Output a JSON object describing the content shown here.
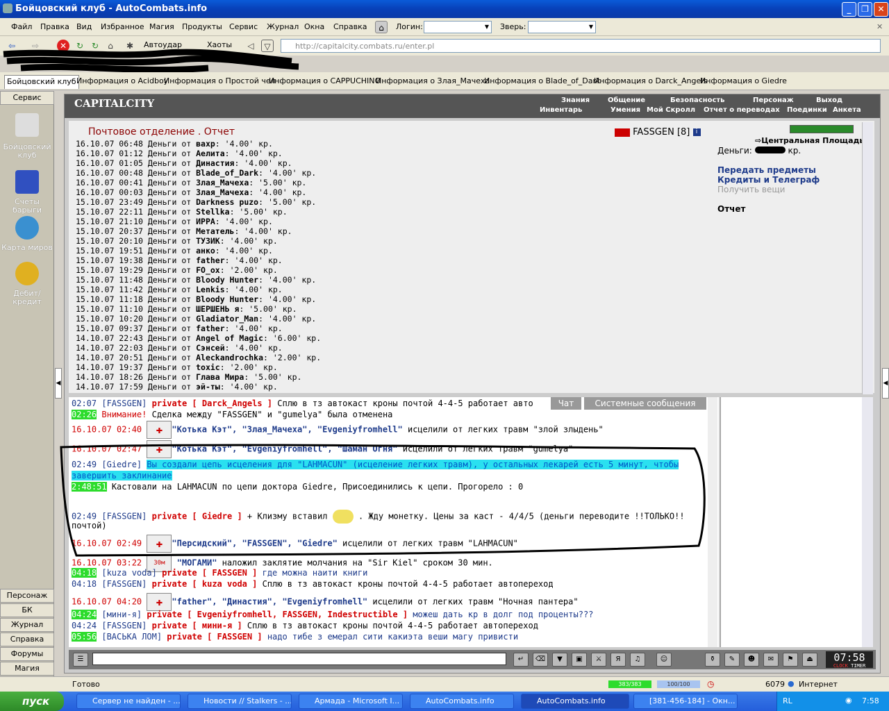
{
  "window": {
    "title": "Бойцовский клуб - AutoCombats.info"
  },
  "menu": {
    "items": [
      "Файл",
      "Правка",
      "Вид",
      "Избранное",
      "Магия",
      "Продукты",
      "Сервис",
      "Журнал",
      "Окна",
      "Справка"
    ],
    "login_label": "Логин:",
    "pet_label": "Зверь:"
  },
  "toolbar": {
    "autostrike": "Автоудар",
    "chaos": "Хаоты",
    "url": "http://capitalcity.combats.ru/enter.pl"
  },
  "tabs": [
    "Бойцовский клуб",
    "Информация о Acidboy",
    "Информация о Простой чел",
    "Информация о CAPPUCHINO",
    "Информация о Злая_Мачеха",
    "Информация о Blade_of_Dark",
    "Информация о Darck_Angels",
    "Информация о Giedre"
  ],
  "sidebar": {
    "header": "Сервис",
    "apps": [
      "Бойцовский клуб",
      "Счеты барыги",
      "Карта миров",
      "Дебит/кредит"
    ],
    "bottom": [
      "Персонаж",
      "БК",
      "Журнал",
      "Справка",
      "Форумы",
      "Магия"
    ]
  },
  "game": {
    "logo": "CAPITALCITY",
    "nav_top": [
      "Знания",
      "Общение",
      "Безопасность",
      "Персонаж",
      "Выход"
    ],
    "nav_bottom": [
      "Инвентарь",
      "Умения",
      "Мой Скролл",
      "Отчет о переводах",
      "Поединки",
      "Анкета"
    ],
    "page_title": "Почтовое отделение .  Отчет",
    "player": "FASSGEN [8]",
    "location": "Центральная Площадь",
    "money_label": "Деньги:",
    "money_suffix": "кр.",
    "links": [
      "Передать предметы",
      "Кредиты и Телеграф"
    ],
    "disabled_link": "Получить вещи",
    "current": "Отчет",
    "log": [
      {
        "d": "16.10.07 06:48 Деньги от ",
        "n": "вахр",
        "v": ": '4.00' кр."
      },
      {
        "d": "16.10.07 01:12 Деньги от ",
        "n": "Аелита",
        "v": ": '4.00' кр."
      },
      {
        "d": "16.10.07 01:05 Деньги от ",
        "n": "Династия",
        "v": ": '4.00' кр."
      },
      {
        "d": "16.10.07 00:48 Деньги от ",
        "n": "Blade_of_Dark",
        "v": ": '4.00' кр."
      },
      {
        "d": "16.10.07 00:41 Деньги от ",
        "n": "Злая_Мачеха",
        "v": ": '5.00' кр."
      },
      {
        "d": "16.10.07 00:03 Деньги от ",
        "n": "Злая_Мачеха",
        "v": ": '4.00' кр."
      },
      {
        "d": "15.10.07 23:49 Деньги от ",
        "n": "Darkness puzo",
        "v": ": '5.00' кр."
      },
      {
        "d": "15.10.07 22:11 Деньги от ",
        "n": "Stellka",
        "v": ": '5.00' кр."
      },
      {
        "d": "15.10.07 21:10 Деньги от ",
        "n": "ИРРА",
        "v": ": '4.00' кр."
      },
      {
        "d": "15.10.07 20:37 Деньги от ",
        "n": "Метатель",
        "v": ": '4.00' кр."
      },
      {
        "d": "15.10.07 20:10 Деньги от ",
        "n": "ТУЗИК",
        "v": ": '4.00' кр."
      },
      {
        "d": "15.10.07 19:51 Деньги от ",
        "n": "анко",
        "v": ": '4.00' кр."
      },
      {
        "d": "15.10.07 19:38 Деньги от ",
        "n": "father",
        "v": ": '4.00' кр."
      },
      {
        "d": "15.10.07 19:29 Деньги от ",
        "n": "FO_ox",
        "v": ": '2.00' кр."
      },
      {
        "d": "15.10.07 11:48 Деньги от ",
        "n": "Bloody Hunter",
        "v": ": '4.00' кр."
      },
      {
        "d": "15.10.07 11:42 Деньги от ",
        "n": "Lenkis",
        "v": ": '4.00' кр."
      },
      {
        "d": "15.10.07 11:18 Деньги от ",
        "n": "Bloody Hunter",
        "v": ": '4.00' кр."
      },
      {
        "d": "15.10.07 11:10 Деньги от ",
        "n": "ШЕРШЕНЬ я",
        "v": ": '5.00' кр."
      },
      {
        "d": "15.10.07 10:20 Деньги от ",
        "n": "Gladiator_Man",
        "v": ": '4.00' кр."
      },
      {
        "d": "15.10.07 09:37 Деньги от ",
        "n": "father",
        "v": ": '4.00' кр."
      },
      {
        "d": "14.10.07 22:43 Деньги от ",
        "n": "Angel of Magic",
        "v": ": '6.00' кр."
      },
      {
        "d": "14.10.07 22:03 Деньги от ",
        "n": "Сэнсей",
        "v": ": '4.00' кр."
      },
      {
        "d": "14.10.07 20:51 Деньги от ",
        "n": "Aleckandrochka",
        "v": ": '2.00' кр."
      },
      {
        "d": "14.10.07 19:37 Деньги от ",
        "n": "toxic",
        "v": ": '2.00' кр."
      },
      {
        "d": "14.10.07 18:26 Деньги от ",
        "n": "Глава Мира",
        "v": ": '5.00' кр."
      },
      {
        "d": "14.10.07 17:59 Деньги от ",
        "n": "эй-ты",
        "v": ": '4.00' кр."
      }
    ]
  },
  "chat": {
    "tab_chat": "Чат",
    "tab_system": "Системные сообщения",
    "l1_time": "02:07",
    "l1_user": "[FASSGEN]",
    "l1_priv": "private [ Darck_Angels ]",
    "l1_msg": "Сплю в тз автокаст кроны почтой 4-4-5 работает авто",
    "l2_time": "02:26",
    "l2_warn": "Внимание!",
    "l2_msg": "Сделка между \"FASSGEN\" и \"gumelya\" была отменена",
    "l3_time": "16.10.07 02:40",
    "l3_names": "\"Котька Кэт\", \"Злая_Мачеха\", \"Evgeniyfromhell\"",
    "l3_msg": "исцелили от легких травм \"злой злыдень\"",
    "l4_time": "16.10.07 02:47",
    "l4_names": "\"Котька Кэт\", \"Evgeniyfromhell\", \"Шаман Огня\"",
    "l4_msg": "исцелили от легких травм \"gumelya\"",
    "l5_time": "02:49",
    "l5_user": "[Giedre]",
    "l5_msg": "Вы создали цепь исцеления для \"LAHMACUN\" (исцеление легких травм), у остальных лекарей есть 5 минут, чтобы",
    "l5_msg2": "завершить заклинание",
    "l6_time": "2:48:51",
    "l6_msg": "Кастовали на LAHMACUN по цепи доктора Giedre, Присоединились к цепи. Прогорело : 0",
    "l7_time": "02:49",
    "l7_user": "[FASSGEN]",
    "l7_priv": "private [ Giedre ]",
    "l7_msg": "+ Клизму вставил",
    "l7_msg2": ". Жду монетку. Цены за каст - 4/4/5 (деньги переводите !!ТОЛЬКО!!",
    "l7_msg3": "почтой)",
    "l8_time": "16.10.07 02:49",
    "l8_names": "\"Персидский\", \"FASSGEN\", \"Giedre\"",
    "l8_msg": "исцелили от легких травм \"LAHMACUN\"",
    "l9_time": "16.10.07 03:22",
    "l9_badge": "30м",
    "l9_names": "\"МОГАМИ\"",
    "l9_msg": "наложил заклятие молчания на \"Sir Kiel\" сроком 30 мин.",
    "l10_time": "04:18",
    "l10_user": "[kuza voda]",
    "l10_priv": "private [ FASSGEN ]",
    "l10_msg": "где можна наити книги",
    "l11_time": "04:18",
    "l11_user": "[FASSGEN]",
    "l11_priv": "private [ kuza voda ]",
    "l11_msg": "Сплю в тз автокаст кроны почтой 4-4-5 работает автопереход",
    "l12_time": "16.10.07 04:20",
    "l12_names": "\"father\", \"Династия\", \"Evgeniyfromhell\"",
    "l12_msg": "исцелили от легких травм \"Ночная пантера\"",
    "l13_time": "04:24",
    "l13_user": "[мини-я]",
    "l13_priv": "private [ Evgeniyfromhell, FASSGEN, Indestructible ]",
    "l13_msg": "можеш дать кр в долг под проценты???",
    "l14_time": "04:24",
    "l14_user": "[FASSGEN]",
    "l14_priv": "private [ мини-я ]",
    "l14_msg": "Сплю в тз автокаст кроны почтой 4-4-5 работает автопереход",
    "l15_time": "05:56",
    "l15_user": "[ВАСЬКА ЛОМ]",
    "l15_priv": "private [ FASSGEN ]",
    "l15_msg": "надо тибе з емерал сити какиэта веши магу привисти",
    "clock": "07:58",
    "clock_labels": [
      "CLOCK",
      "TIMER"
    ]
  },
  "status": {
    "text": "Готово",
    "hp": "383/383",
    "mana": "100/100",
    "count": "6079",
    "zone": "Интернет"
  },
  "taskbar": {
    "start": "пуск",
    "tasks": [
      "Сервер не найден - ...",
      "Новости // Stalkers - ...",
      "Армада - Microsoft I...",
      "AutoCombats.info",
      "AutoCombats.info",
      "[381-456-184] - Окн..."
    ],
    "lang": "RL",
    "time": "7:58"
  },
  "colors": {
    "accent": "#1d3a8a",
    "title_red": "#8b0000",
    "highlight": "#2ae0f0",
    "time_green": "#2ddc2d"
  }
}
